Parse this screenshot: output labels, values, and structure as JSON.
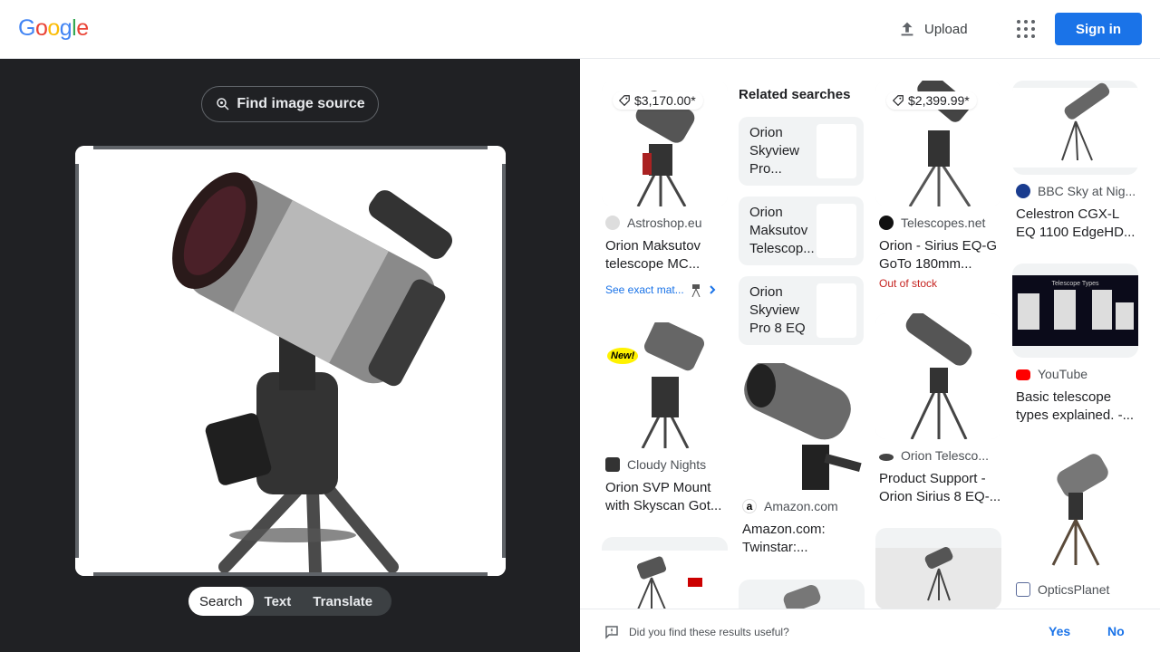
{
  "header": {
    "logo": "Google",
    "upload_label": "Upload",
    "signin_label": "Sign in"
  },
  "lens": {
    "find_source_label": "Find image source",
    "modes": [
      "Search",
      "Text",
      "Translate"
    ],
    "active_mode": "Search"
  },
  "results": {
    "related_heading": "Related searches",
    "related": [
      {
        "label": "Orion Skyview Pro..."
      },
      {
        "label": "Orion Maksutov Telescop..."
      },
      {
        "label": "Orion Skyview Pro 8 EQ"
      }
    ],
    "cards": [
      {
        "price": "$3,170.00*",
        "source": "Astroshop.eu",
        "title": "Orion Maksutov telescope MC...",
        "exact": "See exact mat..."
      },
      {
        "source": "Cloudy Nights",
        "title": "Orion SVP Mount with Skyscan Got..."
      },
      {
        "price": "$2,399.99*",
        "source": "Telescopes.net",
        "title": "Orion - Sirius EQ-G GoTo 180mm...",
        "stock": "Out of stock"
      },
      {
        "source": "Orion Telesco...",
        "title": "Product Support - Orion Sirius 8 EQ-..."
      },
      {
        "source": "Amazon.com",
        "title": "Amazon.com: Twinstar:..."
      },
      {
        "source": "BBC Sky at Nig...",
        "title": "Celestron CGX-L EQ 1100 EdgeHD..."
      },
      {
        "source": "YouTube",
        "title": "Basic telescope types explained. -..."
      },
      {
        "source": "OpticsPlanet"
      }
    ],
    "new_badge": "New!",
    "youtube_thumb_text": "Telescope Types"
  },
  "feedback": {
    "question": "Did you find these results useful?",
    "yes": "Yes",
    "no": "No"
  },
  "colors": {
    "accent": "#1a73e8",
    "dark_bg": "#202124",
    "out_of_stock": "#c5221f"
  }
}
